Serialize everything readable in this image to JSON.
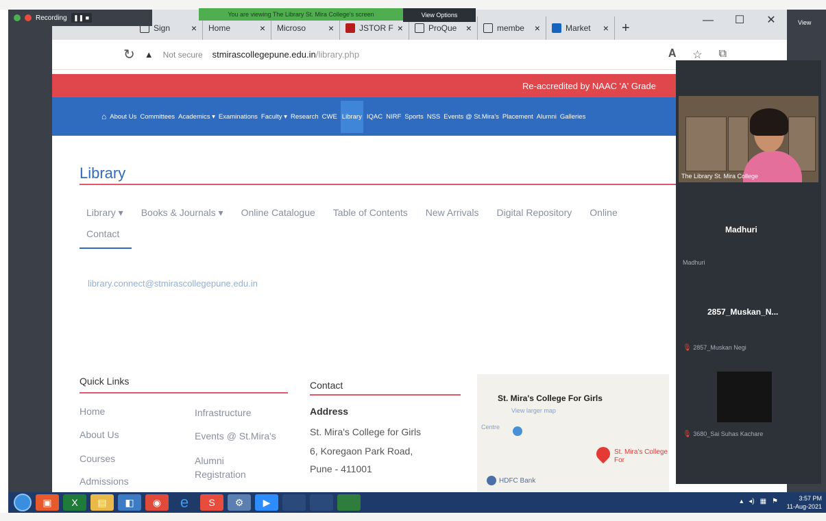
{
  "zoom": {
    "recording_label": "Recording",
    "share_banner": "You are viewing The Library St. Mira College's screen",
    "view_options": "View Options",
    "view_right": "View"
  },
  "browser": {
    "tabs": [
      {
        "label": "Sign",
        "close": "×"
      },
      {
        "label": "Home",
        "close": "×"
      },
      {
        "label": "Microso",
        "close": "×"
      },
      {
        "label": "JSTOR F",
        "close": "×"
      },
      {
        "label": "ProQue",
        "close": "×"
      },
      {
        "label": "membe",
        "close": "×"
      },
      {
        "label": "Market",
        "close": "×"
      }
    ],
    "new_tab": "+",
    "not_secure": "Not secure",
    "url_domain": "stmirascollegepune.edu.in",
    "url_path": "/library.php"
  },
  "site": {
    "accreditation": "Re-accredited by NAAC 'A' Grade",
    "nav": [
      "About Us",
      "Committees",
      "Academics ▾",
      "Examinations",
      "Faculty ▾",
      "Research",
      "CWE",
      "Library",
      "IQAC",
      "NIRF",
      "Sports",
      "NSS",
      "Events @ St.Mira's",
      "Placement",
      "Alumni",
      "Galleries"
    ],
    "page_title": "Library",
    "subnav": [
      "Library ▾",
      "Books & Journals ▾",
      "Online Catalogue",
      "Table of Contents",
      "New Arrivals",
      "Digital Repository",
      "Online"
    ],
    "subnav_active": "Contact",
    "email": "library.connect@stmirascollegepune.edu.in",
    "footer": {
      "quick_links_heading": "Quick Links",
      "col1": [
        "Home",
        "About Us",
        "Courses",
        "Admissions"
      ],
      "col2": [
        "Infrastructure",
        "Events @ St.Mira's",
        "Alumni Registration"
      ],
      "contact_heading": "Contact",
      "address_label": "Address",
      "address_lines": [
        "St. Mira's College for Girls",
        "6, Koregaon Park Road,",
        "Pune - 411001"
      ]
    },
    "map": {
      "title": "St. Mira's College For Girls",
      "view_larger": "View larger map",
      "centre": "Centre",
      "pin_label": "St. Mira's College For",
      "bank": "HDFC Bank"
    }
  },
  "participants": {
    "video_caption": "The Library St. Mira College",
    "p1_name": "Madhuri",
    "p1_small": "Madhuri",
    "p2_name": "2857_Muskan_N...",
    "p2_small": "2857_Muskan Negi",
    "p3_small": "3680_Sai Suhas Kachare"
  },
  "taskbar": {
    "time": "3:57 PM",
    "date": "11-Aug-2021"
  }
}
